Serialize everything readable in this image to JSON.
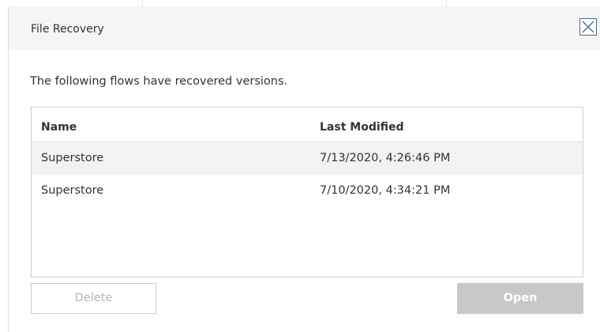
{
  "dialog": {
    "title": "File Recovery",
    "close_icon": "close-icon",
    "message": "The following flows have recovered versions."
  },
  "list": {
    "columns": {
      "name": "Name",
      "last_modified": "Last Modified"
    },
    "rows": [
      {
        "name": "Superstore",
        "last_modified": "7/13/2020, 4:26:46 PM",
        "selected": true
      },
      {
        "name": "Superstore",
        "last_modified": "7/10/2020, 4:34:21 PM",
        "selected": false
      }
    ]
  },
  "buttons": {
    "delete_label": "Delete",
    "open_label": "Open"
  },
  "colors": {
    "titlebar_bg": "#f5f5f5",
    "selected_row_bg": "#f2f2f2",
    "close_border": "#4d6a8f",
    "disabled_button_bg": "#c8c8c8"
  }
}
